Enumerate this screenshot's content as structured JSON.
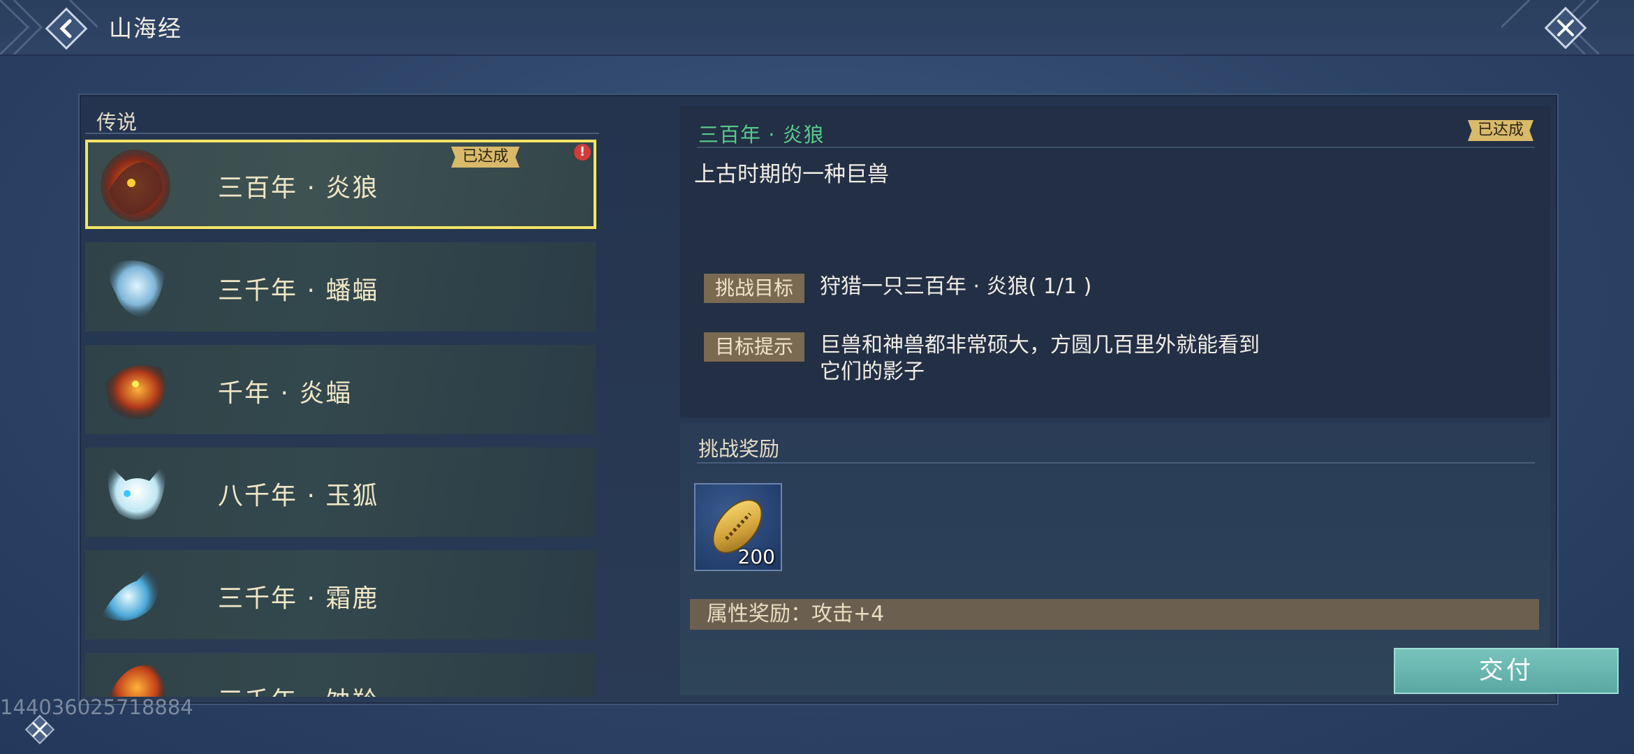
{
  "header": {
    "title": "山海经"
  },
  "list_section": {
    "title": "传说",
    "items": [
      {
        "name": "三百年 · 炎狼",
        "badge": "已达成",
        "alert": "!",
        "selected": true
      },
      {
        "name": "三千年 · 蟠蝠"
      },
      {
        "name": "千年 · 炎蝠"
      },
      {
        "name": "八千年 · 玉狐"
      },
      {
        "name": "三千年 · 霜鹿"
      },
      {
        "name": "三千年 · 蚀羚"
      }
    ]
  },
  "detail": {
    "title": "三百年 · 炎狼",
    "badge": "已达成",
    "description": "上古时期的一种巨兽",
    "challenge_label": "挑战目标",
    "challenge_text": "狩猎一只三百年 · 炎狼( 1/1 )",
    "hint_label": "目标提示",
    "hint_text": "巨兽和神兽都非常硕大，方圆几百里外就能看到它们的影子"
  },
  "rewards": {
    "title": "挑战奖励",
    "item_count": "200",
    "attribute_text": "属性奖励：攻击+4",
    "submit_label": "交付"
  },
  "footer": {
    "uid": "1440360257188​84"
  },
  "colors": {
    "selected_border": "#f4e565",
    "title_green": "#59c98a",
    "badge_gold": "#d9b96a",
    "submit_teal": "#6bb8b1"
  }
}
